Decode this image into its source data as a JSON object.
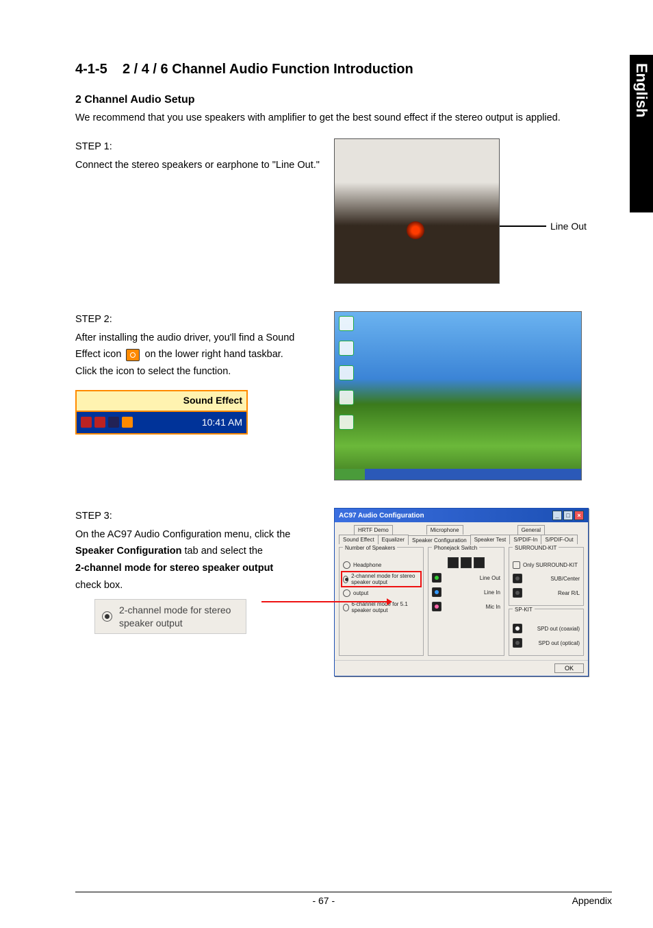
{
  "sideTab": "English",
  "section": {
    "number": "4-1-5",
    "title": "2 / 4 / 6 Channel Audio Function Introduction"
  },
  "sub1": {
    "heading": "2 Channel Audio Setup",
    "para": "We recommend that you use speakers with amplifier to get the best sound effect if the stereo output is applied."
  },
  "step1": {
    "label": "STEP 1:",
    "text": "Connect the stereo speakers or earphone to \"Line Out.\"",
    "callout": "Line Out"
  },
  "step2": {
    "label": "STEP 2:",
    "line1": "After installing the audio driver, you'll find a Sound",
    "line2a": "Effect  icon",
    "line2b": "on the lower right hand taskbar.",
    "line3": "Click the icon to select the function.",
    "tooltip": "Sound Effect",
    "time": "10:41 AM"
  },
  "step3": {
    "label": "STEP 3:",
    "line1": "On the AC97 Audio Configuration menu, click the",
    "line2": "Speaker Configuration",
    "line2b": " tab and select the",
    "line3": "2-channel mode for stereo speaker output",
    "line4": "check box.",
    "checkbox_example": "2-channel mode for stereo speaker output"
  },
  "dialog": {
    "title": "AC97 Audio Configuration",
    "tabsTop": [
      "HRTF Demo",
      "Microphone",
      "General"
    ],
    "tabsBottom": [
      "Sound Effect",
      "Equalizer",
      "Speaker Configuration",
      "Speaker Test",
      "S/PDIF-In",
      "S/PDIF-Out"
    ],
    "groupSpeakers": "Number of Speakers",
    "groupPhonejack": "Phonejack Switch",
    "groupSurround": "SURROUND-KIT",
    "onlySurround": "Only SURROUND-KIT",
    "groupSpkit": "SP-KIT",
    "opts": {
      "headphone": "Headphone",
      "ch2": "2-channel mode for stereo speaker output",
      "ch4": "output",
      "ch6": "6-channel mode for 5.1 speaker output"
    },
    "jacks": {
      "lineout": "Line Out",
      "linein": "Line In",
      "micin": "Mic In"
    },
    "surround": {
      "sub": "SUB/Center",
      "rear": "Rear R/L",
      "coax": "SPD out (coaxial)",
      "opt": "SPD out (optical)"
    },
    "ok": "OK"
  },
  "footer": {
    "page": "- 67 -",
    "section": "Appendix"
  }
}
